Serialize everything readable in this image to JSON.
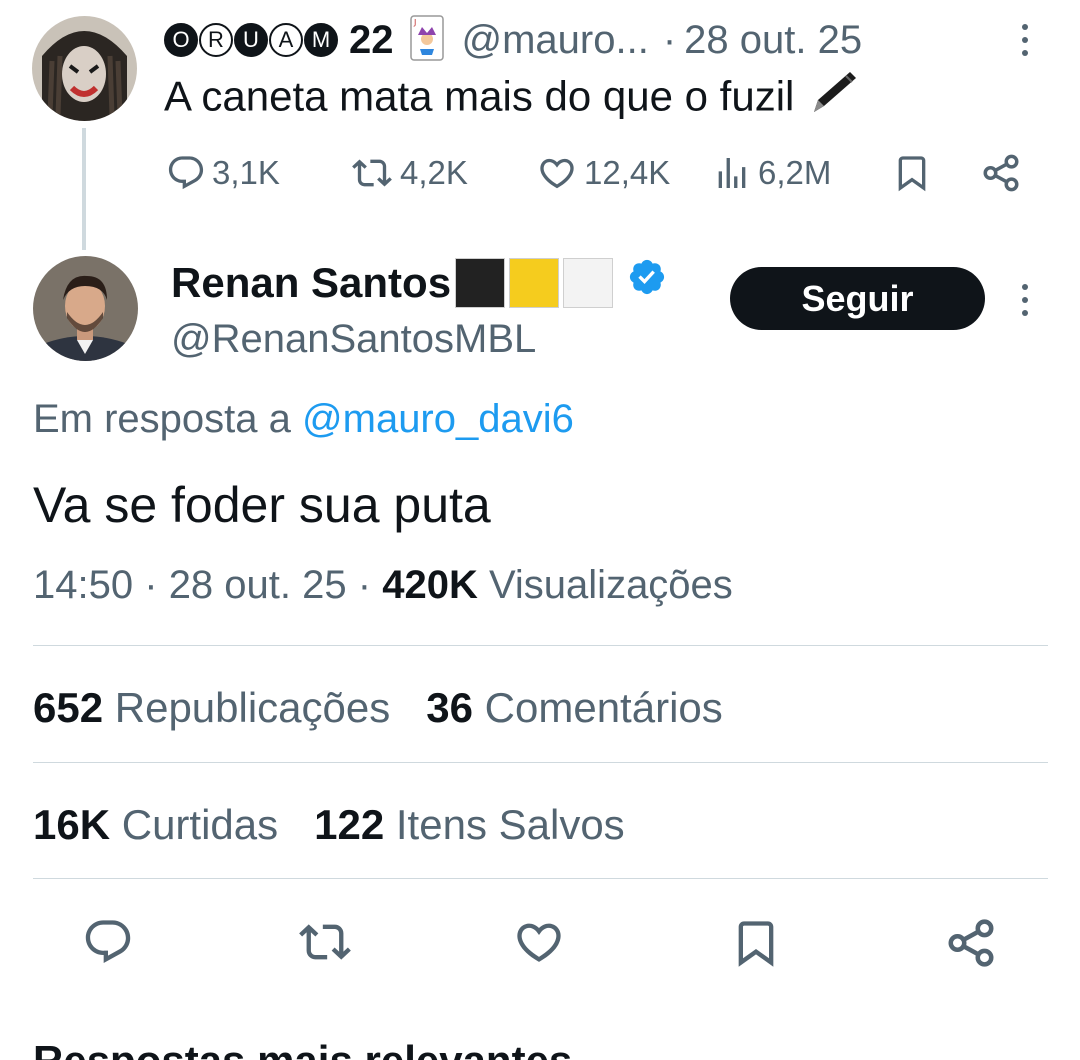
{
  "parent_tweet": {
    "name_badges": [
      "O",
      "R",
      "U",
      "A",
      "M"
    ],
    "name_number": "22",
    "handle": "@mauro...",
    "separator": "·",
    "date": "28 out. 25",
    "text": "A caneta mata mais do que o fuzil",
    "actions": {
      "replies": "3,1K",
      "reposts": "4,2K",
      "likes": "12,4K",
      "views": "6,2M"
    }
  },
  "main_tweet": {
    "display_name": "Renan Santos",
    "flag_colors": [
      "#222222",
      "#f5cc1e",
      "#f3f3f3"
    ],
    "verified": true,
    "handle": "@RenanSantosMBL",
    "follow_label": "Seguir",
    "reply_prefix": "Em resposta a",
    "reply_mention": "@mauro_davi6",
    "text": "Va se foder sua puta",
    "time": "14:50",
    "sep1": "·",
    "date": "28 out. 25",
    "sep2": "·",
    "views_count": "420K",
    "views_label": "Visualizações",
    "stats": {
      "reposts_count": "652",
      "reposts_label": "Republicações",
      "comments_count": "36",
      "comments_label": "Comentários",
      "likes_count": "16K",
      "likes_label": "Curtidas",
      "saves_count": "122",
      "saves_label": "Itens Salvos"
    }
  },
  "next_section_title": "Respostas mais relevantes",
  "colors": {
    "text": "#0f1419",
    "secondary": "#536471",
    "link": "#1d9bf0",
    "divider": "#cfd9de",
    "follow_bg": "#0f1419"
  },
  "icons": [
    "reply-icon",
    "repost-icon",
    "like-icon",
    "views-icon",
    "bookmark-icon",
    "share-icon",
    "verified-icon",
    "more-icon",
    "pen-icon",
    "joker-card-icon"
  ]
}
